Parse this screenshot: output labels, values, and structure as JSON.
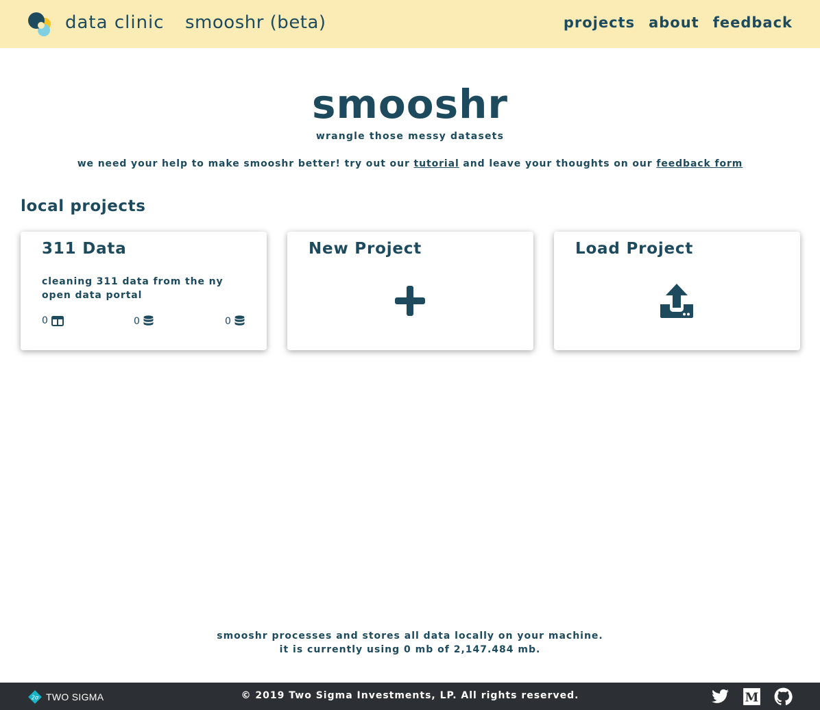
{
  "header": {
    "brand": "data clinic",
    "product": "smooshr (beta)",
    "nav": [
      "projects",
      "about",
      "feedback"
    ]
  },
  "hero": {
    "title": "smooshr",
    "subtitle": "wrangle those messy datasets",
    "help_prefix": "we need your help to make smooshr better! try out our ",
    "tutorial_link": "tutorial",
    "help_middle": " and leave your thoughts on our ",
    "feedback_link": "feedback form"
  },
  "section_title": "local projects",
  "cards": {
    "project": {
      "title": "311 Data",
      "description": "cleaning 311 data from the ny open data portal",
      "stats": [
        "0",
        "0",
        "0"
      ],
      "stat_icons": [
        "table-icon",
        "database-icon",
        "database-icon"
      ]
    },
    "new": {
      "title": "New Project",
      "icon": "plus-icon"
    },
    "load": {
      "title": "Load Project",
      "icon": "upload-icon"
    }
  },
  "storage": {
    "line1": "smooshr processes and stores all data locally on your machine.",
    "line2": "it is currently using 0 mb of 2,147.484 mb."
  },
  "footer": {
    "company_logo_text": "TWO SIGMA",
    "copyright": "© 2019 Two Sigma Investments, LP. All rights reserved.",
    "social": [
      "twitter-icon",
      "medium-icon",
      "github-icon"
    ]
  },
  "colors": {
    "primary": "#1d4a5d",
    "header_bg": "#fbecb6",
    "footer_bg": "#2c2f33",
    "logo_yellow": "#f5c324",
    "logo_cyan": "#7fd0e3"
  }
}
